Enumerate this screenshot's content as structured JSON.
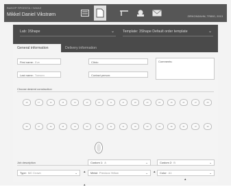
{
  "header": {
    "small_label": "ВЫБОР ПРОЕКТА / ЗАКАЗ",
    "user_name": "Mikkel Daniel Vikstrøm",
    "right_label": "ZIRKONZAHN, TRIBO, 2013",
    "tools": [
      {
        "name": "tool-list-icon"
      },
      {
        "name": "tool-order-icon"
      },
      {
        "name": "tool-scan-icon"
      },
      {
        "name": "tool-mill-icon"
      },
      {
        "name": "tool-mail-icon"
      }
    ]
  },
  "lab_select": {
    "label": "Lab:",
    "value": "3Shape"
  },
  "template_select": {
    "label": "Template:",
    "value": "3Shape Default order template"
  },
  "tabs": {
    "general": "General information",
    "delivery": "Delivery information"
  },
  "patient": {
    "first_name_label": "First name:",
    "first_name_value": "Eve",
    "last_name_label": "Last name:",
    "last_name_value": "Tomsen",
    "clinic_label": "Clinic:",
    "contact_label": "Contact person:",
    "comments_label": "Comments:"
  },
  "construction_title": "Choose desired construction",
  "upper_teeth": [
    "18",
    "17",
    "16",
    "15",
    "14",
    "13",
    "12",
    "11",
    "21",
    "22",
    "23",
    "24",
    "25",
    "26",
    "27",
    "28"
  ],
  "lower_teeth": [
    "48",
    "47",
    "46",
    "45",
    "44",
    "43",
    "42",
    "41",
    "31",
    "32",
    "33",
    "34",
    "35",
    "36",
    "37",
    "38"
  ],
  "job_title": "Job description",
  "job": {
    "type_label": "Type:",
    "type_value": "MC Crown",
    "metal_label": "Metal:",
    "metal_value": "Precious Yellow",
    "color_label": "Color:",
    "color_value": "A1",
    "custom1_label": "Custom 1:",
    "custom1_value": "A",
    "custom2_label": "Custom 2:",
    "custom2_value": "B"
  }
}
